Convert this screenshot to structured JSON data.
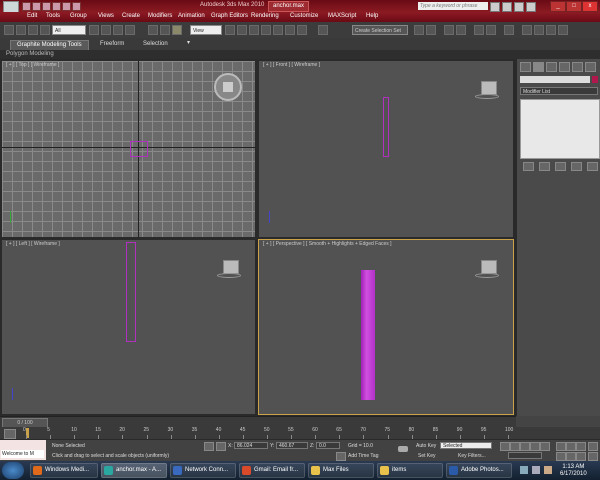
{
  "window": {
    "app_title": "Autodesk 3ds Max 2010",
    "file_tab": "anchor.max",
    "search_placeholder": "Type a keyword or phrase",
    "btn_min": "_",
    "btn_max": "□",
    "btn_close": "x"
  },
  "menu": [
    "Edit",
    "Tools",
    "Group",
    "Views",
    "Create",
    "Modifiers",
    "Animation",
    "Graph Editors",
    "Rendering",
    "Customize",
    "MAXScript",
    "Help"
  ],
  "toolbar": {
    "selection_filter": "All",
    "ref_coord": "View",
    "named_selection": "Create Selection Set"
  },
  "ribbon": {
    "tabs": [
      "Graphite Modeling Tools",
      "Freeform",
      "Selection"
    ],
    "active_tab": 0,
    "expander": "▾",
    "subpanel": "Polygon Modeling"
  },
  "viewports": {
    "top": "[ + ] [ Top ] [ Wireframe ]",
    "front": "[ + ] [ Front ] [ Wireframe ]",
    "left": "[ + ] [ Left ] [ Wireframe ]",
    "perspective": "[ + ] [ Perspective ] [ Smooth + Highlights + Edged Faces ]"
  },
  "command_panel": {
    "modifier_list": "Modifier List",
    "object_color": "#b0174d"
  },
  "timeline": {
    "frame_display": "0 / 100",
    "ticks": [
      "0",
      "5",
      "10",
      "15",
      "20",
      "25",
      "30",
      "35",
      "40",
      "45",
      "50",
      "55",
      "60",
      "65",
      "70",
      "75",
      "80",
      "85",
      "90",
      "95",
      "100"
    ]
  },
  "status": {
    "welcome": "Welcome to M",
    "selection": "None Selected",
    "prompt": "Click and drag to select and scale objects (uniformly)",
    "x_label": "X:",
    "x_value": "86.024",
    "y_label": "Y:",
    "y_value": "460.67",
    "z_label": "Z:",
    "z_value": "0.0",
    "grid": "Grid = 10.0",
    "add_time_tag": "Add Time Tag",
    "auto_key": "Auto Key",
    "set_key": "Set Key",
    "selected": "Selected",
    "key_filters": "Key Filters..."
  },
  "taskbar": {
    "items": [
      {
        "label": "Windows Medi...",
        "color": "#e06a1a"
      },
      {
        "label": "anchor.max - A...",
        "color": "#2aa7a0"
      },
      {
        "label": "Network Conn...",
        "color": "#3a6ac0"
      },
      {
        "label": "Gmail: Email fr...",
        "color": "#d84a2a"
      },
      {
        "label": "Max Files",
        "color": "#e8c24a"
      },
      {
        "label": "items",
        "color": "#e8c24a"
      },
      {
        "label": "Adobe Photos...",
        "color": "#2a5aa8"
      }
    ],
    "time": "1:13 AM",
    "date": "6/17/2010"
  },
  "colors": {
    "object_purple": "#c03ad0",
    "active_viewport_border": "#c9a24a"
  }
}
